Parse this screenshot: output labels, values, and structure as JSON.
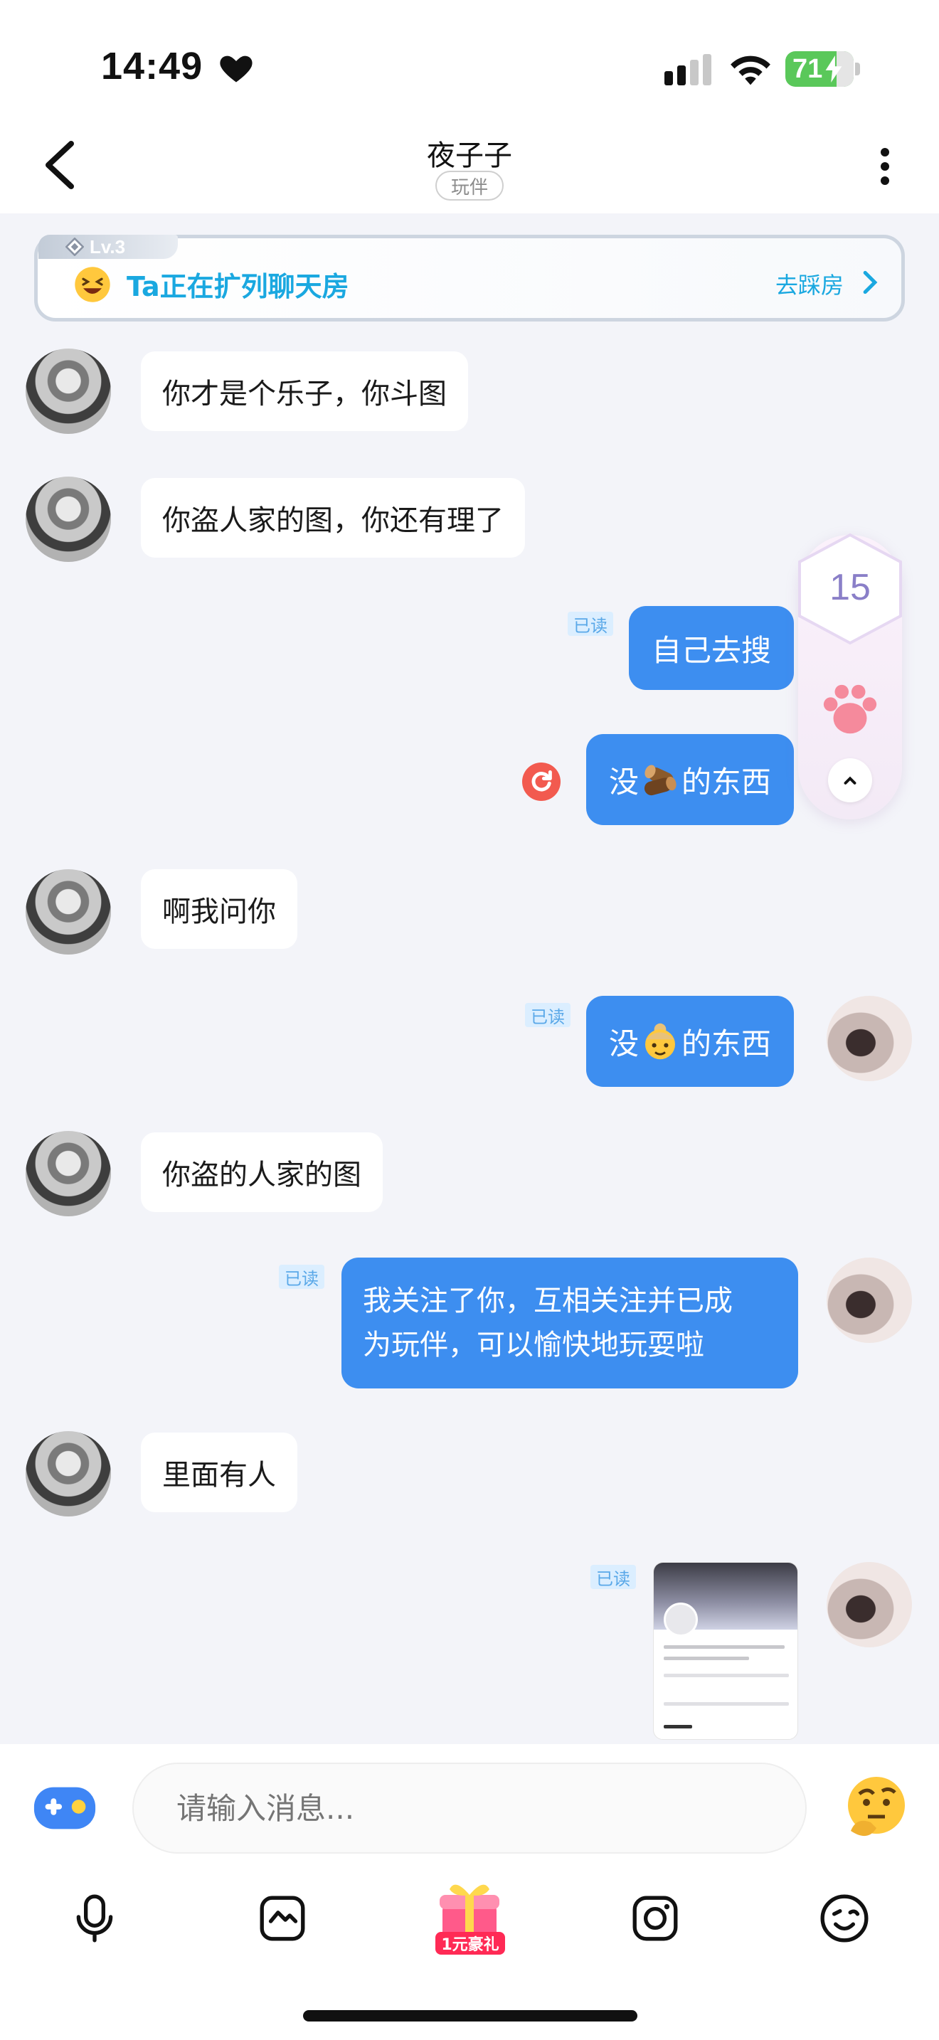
{
  "status_bar": {
    "time": "14:49",
    "battery": "71"
  },
  "nav": {
    "title": "夜子子",
    "tag": "玩伴"
  },
  "banner": {
    "level": "Lv.3",
    "text": "Ta正在扩列聊天房",
    "link": "去踩房"
  },
  "messages": [
    {
      "from": "other",
      "text": "你才是个乐子，你斗图"
    },
    {
      "from": "other",
      "text": "你盗人家的图，你还有理了"
    },
    {
      "from": "me",
      "text": "自己去搜",
      "read": "已读"
    },
    {
      "from": "me",
      "text_before": "没",
      "emoji": "log-emoji",
      "text_after": "的东西",
      "status": "failed-retry"
    },
    {
      "from": "other",
      "text": "啊我问你"
    },
    {
      "from": "me",
      "text_before": "没",
      "emoji": "grandma-emoji",
      "text_after": "的东西",
      "read": "已读"
    },
    {
      "from": "other",
      "text": "你盗的人家的图"
    },
    {
      "from": "me",
      "lines": [
        "我关注了你，互相关注并已成",
        "为玩伴，可以愉快地玩耍啦"
      ],
      "read": "已读"
    },
    {
      "from": "other",
      "text": "里面有人"
    },
    {
      "from": "me",
      "type": "image",
      "read": "已读"
    }
  ],
  "float_widget": {
    "count": "15"
  },
  "input": {
    "placeholder": "请输入消息..."
  },
  "toolbar": {
    "gift_label": "1元豪礼"
  },
  "colors": {
    "accent_blue": "#3d8ef0",
    "banner_text": "#1aa8e0",
    "gift_red": "#ff2a55"
  }
}
